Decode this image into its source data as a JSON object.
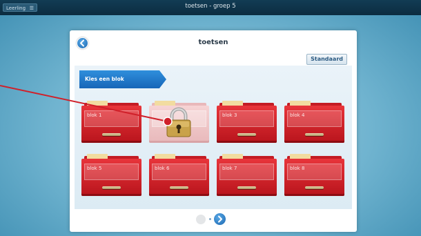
{
  "topbar": {
    "leerling_label": "Leerling",
    "menu_glyph": "☰",
    "title": "toetsen - groep 5"
  },
  "page": {
    "title": "toetsen",
    "standaard_label": "Standaard",
    "kies_label": "Kies een blok"
  },
  "blocks": [
    {
      "label": "blok 1",
      "locked": false
    },
    {
      "label": "",
      "locked": true
    },
    {
      "label": "blok 3",
      "locked": false
    },
    {
      "label": "blok 4",
      "locked": false
    },
    {
      "label": "blok 5",
      "locked": false
    },
    {
      "label": "blok 6",
      "locked": false
    },
    {
      "label": "blok 7",
      "locked": false
    },
    {
      "label": "blok 8",
      "locked": false
    }
  ],
  "icons": {
    "back": "back-arrow-icon",
    "next": "next-arrow-icon",
    "lock": "padlock-icon"
  },
  "colors": {
    "drawer_red": "#d8262e",
    "accent_blue": "#1c67b0",
    "topbar": "#0c2c40",
    "annotation": "#d0202a"
  }
}
